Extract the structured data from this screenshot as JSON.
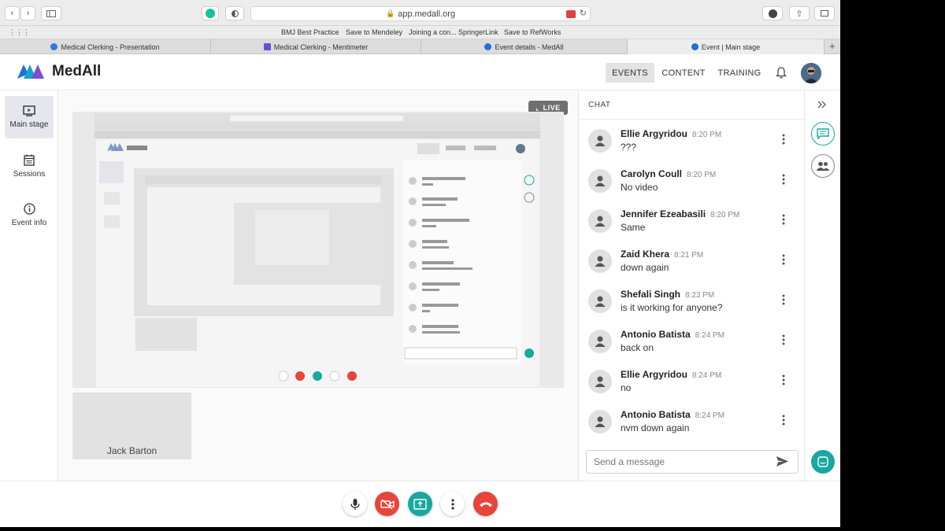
{
  "browser": {
    "url": "app.medall.org",
    "bookmarks": [
      "BMJ Best Practice",
      "Save to Mendeley",
      "Joining a con... SpringerLink",
      "Save to RefWorks"
    ],
    "tabs": [
      {
        "label": "Medical Clerking - Presentation"
      },
      {
        "label": "Medical Clerking - Mentimeter"
      },
      {
        "label": "Event details - MedAll"
      },
      {
        "label": "Event | Main stage"
      }
    ]
  },
  "app": {
    "brand": "MedAll",
    "nav": {
      "events": "EVENTS",
      "content": "CONTENT",
      "training": "TRAINING"
    },
    "sidebar": [
      {
        "label": "Main stage"
      },
      {
        "label": "Sessions"
      },
      {
        "label": "Event info"
      }
    ],
    "live_badge": "LIVE",
    "participant": "Jack Barton",
    "chat": {
      "title": "CHAT",
      "placeholder": "Send a message",
      "messages": [
        {
          "name": "Ellie Argyridou",
          "time": "8:20 PM",
          "text": "???"
        },
        {
          "name": "Carolyn Coull",
          "time": "8:20 PM",
          "text": "No video"
        },
        {
          "name": "Jennifer Ezeabasili",
          "time": "8:20 PM",
          "text": "Same"
        },
        {
          "name": "Zaid Khera",
          "time": "8:21 PM",
          "text": "down again"
        },
        {
          "name": "Shefali Singh",
          "time": "8:23 PM",
          "text": "is it working for anyone?"
        },
        {
          "name": "Antonio Batista",
          "time": "8:24 PM",
          "text": "back on"
        },
        {
          "name": "Ellie Argyridou",
          "time": "8:24 PM",
          "text": "no"
        },
        {
          "name": "Antonio Batista",
          "time": "8:24 PM",
          "text": "nvm down again"
        }
      ]
    }
  },
  "colors": {
    "accent_teal": "#1aa7a0",
    "danger": "#e8443a",
    "brand_blue": "#1e6fd9"
  }
}
